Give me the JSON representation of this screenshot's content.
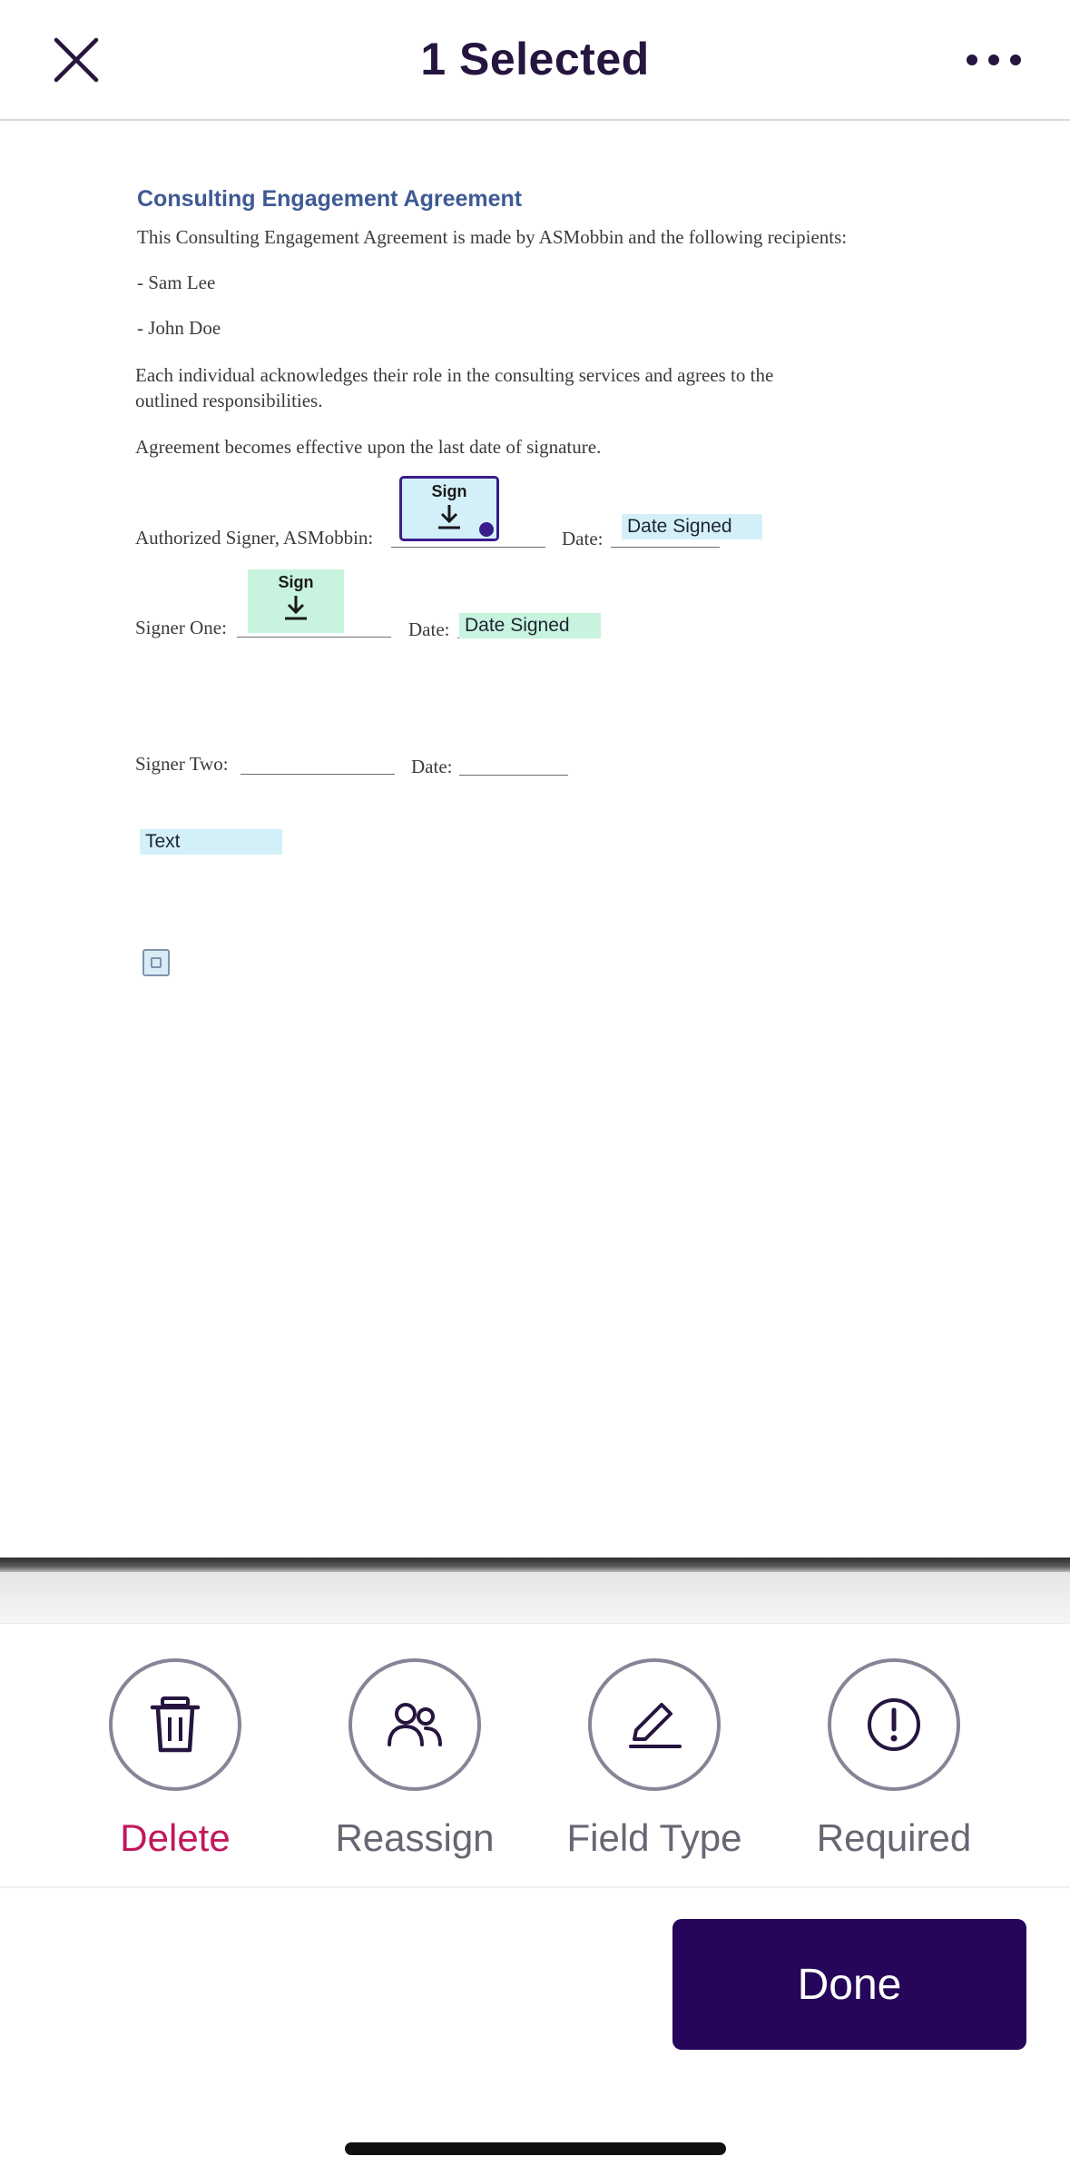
{
  "header": {
    "title": "1 Selected",
    "close_icon": "close-icon",
    "more_icon": "more-horizontal-icon"
  },
  "document": {
    "title": "Consulting Engagement Agreement",
    "intro": "This Consulting Engagement Agreement is made by ASMobbin and the following recipients:",
    "recipient_1": "- Sam Lee",
    "recipient_2": "- John Doe",
    "ack_line_1": "Each individual acknowledges their role in the consulting services and agrees to the",
    "ack_line_2": "outlined responsibilities.",
    "effective": "Agreement becomes effective upon the last date of signature.",
    "authorized_label": "Authorized Signer, ASMobbin:",
    "date_label": "Date:",
    "signer_one_label": "Signer One:",
    "signer_two_label": "Signer Two:"
  },
  "fields": {
    "sign_label": "Sign",
    "date_signed_label": "Date Signed",
    "text_label": "Text",
    "selected_color": "#3b1c8c",
    "recipient1_color": "#d3f0f9",
    "recipient2_color": "#c8f3de"
  },
  "actions": {
    "delete": "Delete",
    "reassign": "Reassign",
    "field_type": "Field Type",
    "required": "Required"
  },
  "footer": {
    "done": "Done"
  }
}
